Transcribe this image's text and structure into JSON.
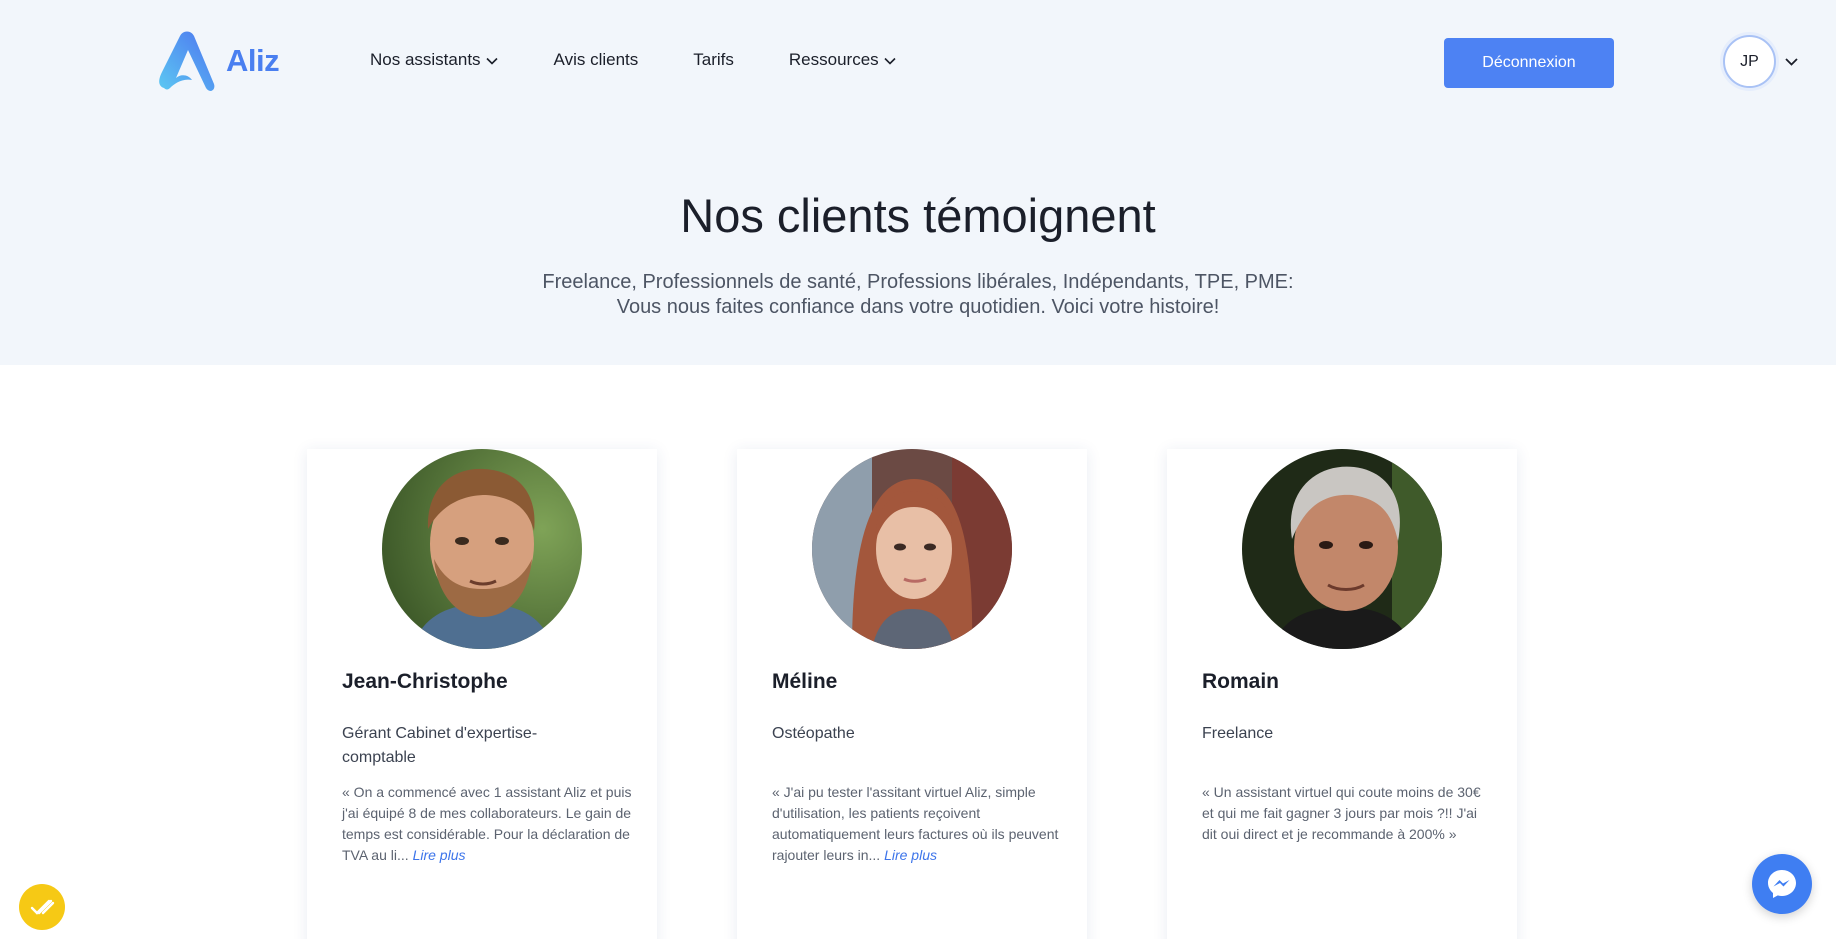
{
  "brand": {
    "name": "Aliz"
  },
  "nav": {
    "items": [
      {
        "label": "Nos assistants",
        "has_dropdown": true
      },
      {
        "label": "Avis clients",
        "has_dropdown": false
      },
      {
        "label": "Tarifs",
        "has_dropdown": false
      },
      {
        "label": "Ressources",
        "has_dropdown": true
      }
    ]
  },
  "header": {
    "logout_label": "Déconnexion",
    "avatar_initials": "JP"
  },
  "hero": {
    "title": "Nos clients témoignent",
    "subtitle_line1": "Freelance, Professionnels de santé, Professions libérales, Indépendants, TPE, PME:",
    "subtitle_line2": "Vous nous faites confiance dans votre quotidien. Voici votre histoire!"
  },
  "testimonials": [
    {
      "name": "Jean-Christophe",
      "role": "Gérant Cabinet d'expertise-comptable",
      "quote": "« On a commencé avec 1 assistant Aliz et puis j'ai équipé 8 de mes collaborateurs. Le gain de temps est considérable. Pour la déclaration de TVA au li...",
      "read_more": "Lire plus"
    },
    {
      "name": "Méline",
      "role": "Ostéopathe",
      "quote": "« J'ai pu tester l'assitant virtuel Aliz, simple d'utilisation, les patients reçoivent automatiquement leurs factures où ils peuvent rajouter leurs in...",
      "read_more": "Lire plus"
    },
    {
      "name": "Romain",
      "role": "Freelance",
      "quote": "« Un assistant virtuel qui coute moins de 30€ et qui me fait gagner 3 jours par mois ?!! J'ai dit oui direct et je recommande à 200% »",
      "read_more": ""
    }
  ],
  "colors": {
    "accent": "#4d82f3",
    "hero_bg": "#f2f6fb",
    "link": "#3c74ea",
    "badge": "#f6c915"
  },
  "icons": {
    "nav_dropdown": "chevron-down-icon",
    "messenger": "messenger-icon",
    "cookie_badge": "cookie-consent-icon"
  }
}
